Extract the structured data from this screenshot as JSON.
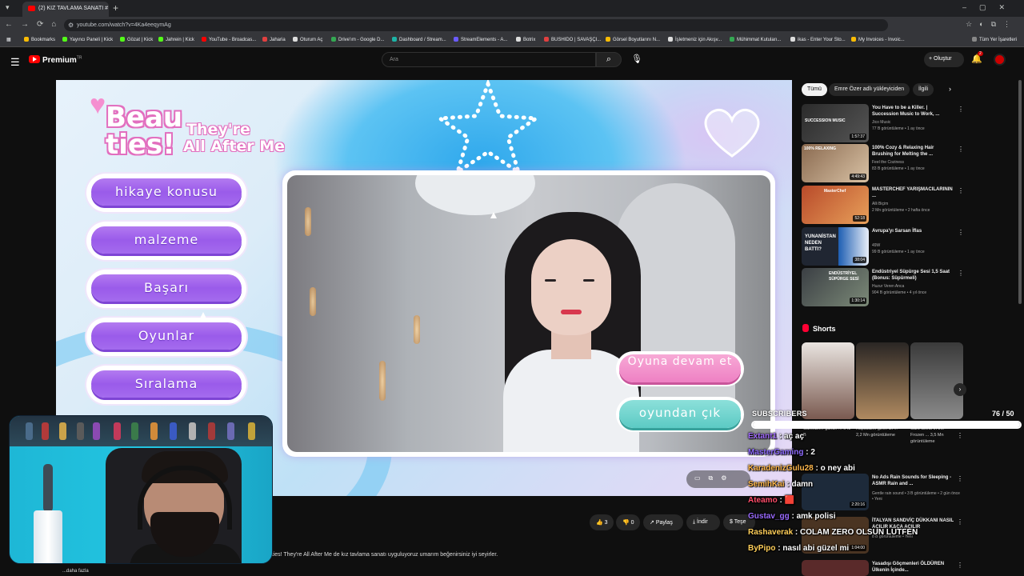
{
  "browser": {
    "tab_title": "(2) KIZ TAVLAMA SANATI #",
    "url": "youtube.com/watch?v=4Ka4eeqymAg",
    "bookmarks": [
      "Bookmarks",
      "Yayıncı Paneli | Kick",
      "Gözat | Kick",
      "Jahrein | Kick",
      "YouTube - Broadcas...",
      "Jaharia",
      "Oturum Aç",
      "Drive'ım - Google D...",
      "Dashboard / Stream...",
      "StreamElements - A...",
      "Botrix",
      "BUSHIDO | SAVAŞÇI...",
      "Görsel Boyutlarını N...",
      "İşletmeniz için Akışv...",
      "Mühimmat Kutuları...",
      "ikas - Enter Your Sto...",
      "My Invoices - Invoic...",
      "Tüm Yer İşaretleri"
    ]
  },
  "yt": {
    "logo": "Premium",
    "logo_sup": "TR",
    "search_placeholder": "Ara",
    "create_label": "Oluştur",
    "notif_count": "2"
  },
  "game": {
    "logo_line1": "Beau",
    "logo_line2": "ties!",
    "logo_theyre": "They're",
    "logo_after": "All After Me",
    "menu": [
      "hikaye konusu",
      "malzeme",
      "Başarı",
      "Oyunlar",
      "Sıralama"
    ],
    "continue_btn": "Oyuna devam et",
    "exit_btn": "oyundan çık"
  },
  "video_actions": {
    "like_count": "3",
    "dislike_count": "0",
    "share_label": "Paylaş",
    "download_label": "İndir",
    "thanks_label": "Teşe"
  },
  "description": "...uties! They're All After Me de kız tavlama sanatı uyguluyoruz umarım beğenirsiniz iyi seyirler.",
  "more_label": "...daha fazla",
  "chips": [
    "Tümü",
    "Emre Özer adlı yükleyiciden",
    "İlgili"
  ],
  "recs": [
    {
      "title": "You Have to be a Killer. | Succession Music to Work, ...",
      "channel": "Jico Music",
      "meta": "77 B görüntüleme • 1 ay önce",
      "duration": "1:57:37"
    },
    {
      "title": "100% Cozy & Relaxing Hair Brushing for Melting the ...",
      "channel": "Feel the Coziness",
      "meta": "83 B görüntüleme • 1 ay önce",
      "duration": "4:49:43"
    },
    {
      "title": "MASTERCHEF YARIŞMACILARININ ...",
      "channel": "Alli Biçim",
      "meta": "2 Mn görüntüleme • 2 hafta önce",
      "duration": "52:18"
    },
    {
      "title": "Avrupa'yı Sarsan İflas",
      "channel": "49W",
      "meta": "99 B görüntüleme • 1 ay önce",
      "duration": "38:04"
    },
    {
      "title": "Endüstriyel Süpürge Sesi 1,5 Saat (Bonus: Süpürmeli)",
      "channel": "Huzur Veren Anca",
      "meta": "904 B görüntüleme • 4 yıl önce",
      "duration": "1:30:14"
    }
  ],
  "rec_thumb_texts": [
    "SUCCESSION MUSIC",
    "100% RELAXING",
    "MasterChef",
    "YUNANİSTAN NEDEN BATTI?",
    "ENDÜSTRİYEL SÜPÜRGE SESİ"
  ],
  "shorts_title": "Shorts",
  "short_labels": [
    "Cumhurİ... günün ... 641 B",
    "Kapitalizm giren ilk ... 2,2 Mn görüntüleme",
    "Cant Climb in the Frozen ... 3,5 Mn görüntüleme"
  ],
  "lower_recs": [
    {
      "title": "No Ads Rain Sounds for Sleeping - ASMR Rain and ...",
      "meta": "Gentle rain sound • 3 B görüntüleme • 2 gün önce • Yeni",
      "duration": "2:20:16"
    },
    {
      "title": "İTALYAN SANDVİÇ DÜKKANI NASIL AÇILIR KAÇA AÇILIR",
      "meta": "8 B görüntüleme • Yeni",
      "duration": "1:04:00"
    },
    {
      "title": "Yasadışı Göçmenleri ÖLDÜREN Ülkenin İçinde...",
      "meta": "",
      "duration": ""
    }
  ],
  "overlay": {
    "subs_label": "SUBSCRIBERS",
    "subs_count": "76  / 50",
    "subs_progress": 1.0,
    "chat": [
      {
        "user": "Extant1",
        "msg": "aç aç",
        "color": "#a26bff"
      },
      {
        "user": "MasterGaming",
        "msg": "2",
        "color": "#8f6bff"
      },
      {
        "user": "KaradenizGulu28",
        "msg": "o ney abi",
        "color": "#ffb84d"
      },
      {
        "user": "SemihKai",
        "msg": "damn",
        "color": "#ffb84d"
      },
      {
        "user": "Ateamo",
        "msg": "🟥",
        "color": "#ff4d6a"
      },
      {
        "user": "Gustav_gg",
        "msg": "amk polisi",
        "color": "#9b6bff"
      },
      {
        "user": "Rashaverak",
        "msg": "COLAM ZERO OLSUN LÜTFEN",
        "color": "#ffcf5a"
      },
      {
        "user": "ByPipo",
        "msg": "nasıl abi güzel mi",
        "color": "#ffcf5a"
      }
    ]
  },
  "colors": {
    "yt_red": "#ff0000",
    "menu_purple": "#9a5bea",
    "pink_btn": "#ee80c3",
    "teal_btn": "#5ccac4"
  }
}
